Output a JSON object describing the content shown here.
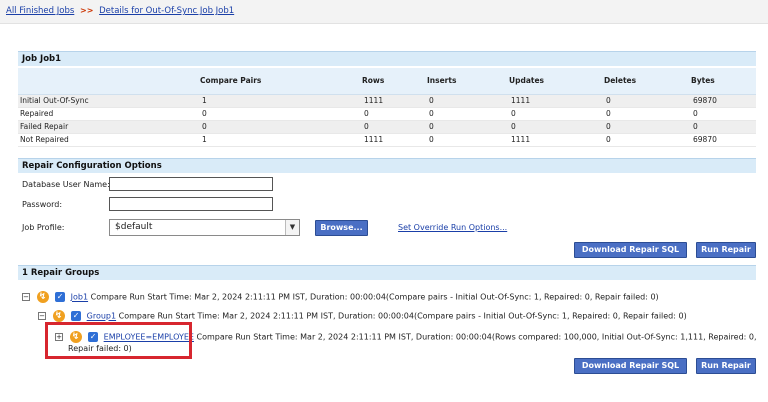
{
  "breadcrumb": {
    "item1": "All Finished Jobs",
    "separator": ">>",
    "item2": "Details for Out-Of-Sync Job Job1"
  },
  "job": {
    "title": "Job Job1",
    "columns": [
      "",
      "Compare Pairs",
      "Rows",
      "Inserts",
      "Updates",
      "Deletes",
      "Bytes"
    ],
    "rows": [
      [
        "Initial Out-Of-Sync",
        "1",
        "1111",
        "0",
        "1111",
        "0",
        "69870"
      ],
      [
        "Repaired",
        "0",
        "0",
        "0",
        "0",
        "0",
        "0"
      ],
      [
        "Failed Repair",
        "0",
        "0",
        "0",
        "0",
        "0",
        "0"
      ],
      [
        "Not Repaired",
        "1",
        "1111",
        "0",
        "1111",
        "0",
        "69870"
      ]
    ]
  },
  "repair_config": {
    "title": "Repair Configuration Options",
    "db_user_label": "Database User Name:",
    "db_user_value": "",
    "password_label": "Password:",
    "password_value": "",
    "job_profile_label": "Job Profile:",
    "job_profile_value": "$default",
    "browse_label": "Browse...",
    "override_link": "Set Override Run Options..."
  },
  "actions": {
    "download_sql": "Download Repair SQL",
    "run_repair": "Run Repair"
  },
  "repair_groups": {
    "title": "1 Repair Groups",
    "job_link": "Job1",
    "job_text": "Compare Run Start Time: Mar 2, 2024 2:11:11 PM IST, Duration: 00:00:04(Compare pairs - Initial Out-Of-Sync: 1, Repaired: 0, Repair failed: 0)",
    "group_link": "Group1",
    "group_text": "Compare Run Start Time: Mar 2, 2024 2:11:11 PM IST, Duration: 00:00:04(Compare pairs - Initial Out-Of-Sync: 1, Repaired: 0, Repair failed: 0)",
    "pair_link": "EMPLOYEE=EMPLOYEE",
    "pair_text": "Compare Run Start Time: Mar 2, 2024 2:11:11 PM IST, Duration: 00:00:04(Rows compared: 100,000, Initial Out-Of-Sync: 1,111, Repaired: 0,",
    "pair_text_cont": "Repair failed: 0)"
  },
  "colors": {
    "accent": "#4a6fc4",
    "header_bar": "#d9ebf8",
    "highlight": "#d7262f"
  }
}
